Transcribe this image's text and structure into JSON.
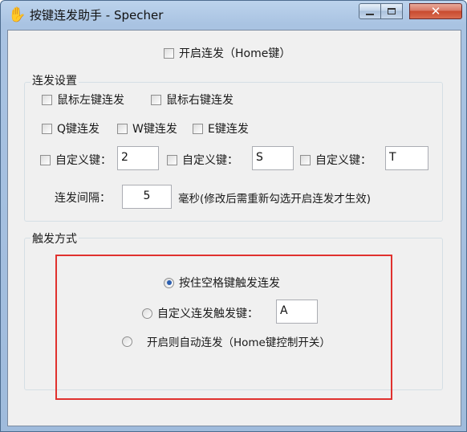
{
  "window": {
    "title": "按键连发助手 - Specher",
    "icon": "hand-icon",
    "controls": {
      "minimize": "minimize-icon",
      "maximize": "maximize-icon",
      "close": "✕"
    }
  },
  "enable": {
    "label": "开启连发（Home键）",
    "checked": false
  },
  "settings": {
    "group_label": "连发设置",
    "mouse_left": "鼠标左键连发",
    "mouse_right": "鼠标右键连发",
    "q_key": "Q键连发",
    "w_key": "W键连发",
    "e_key": "E键连发",
    "custom1_label": "自定义键：",
    "custom1_value": "2",
    "custom2_label": "自定义键：",
    "custom2_value": "S",
    "custom3_label": "自定义键：",
    "custom3_value": "T",
    "interval_label": "连发间隔：",
    "interval_value": "5",
    "interval_unit": "毫秒(修改后需重新勾选开启连发才生效)"
  },
  "trigger": {
    "group_label": "触发方式",
    "option_space": "按住空格键触发连发",
    "option_space_checked": true,
    "option_custom": "自定义连发触发键：",
    "option_custom_value": "A",
    "option_auto": "开启则自动连发（Home键控制开关）"
  },
  "colors": {
    "title_bar": "#a9c3e2",
    "client_bg": "#f0f0f0",
    "highlight_frame": "#e0312e",
    "close_button": "#c84a2f"
  }
}
